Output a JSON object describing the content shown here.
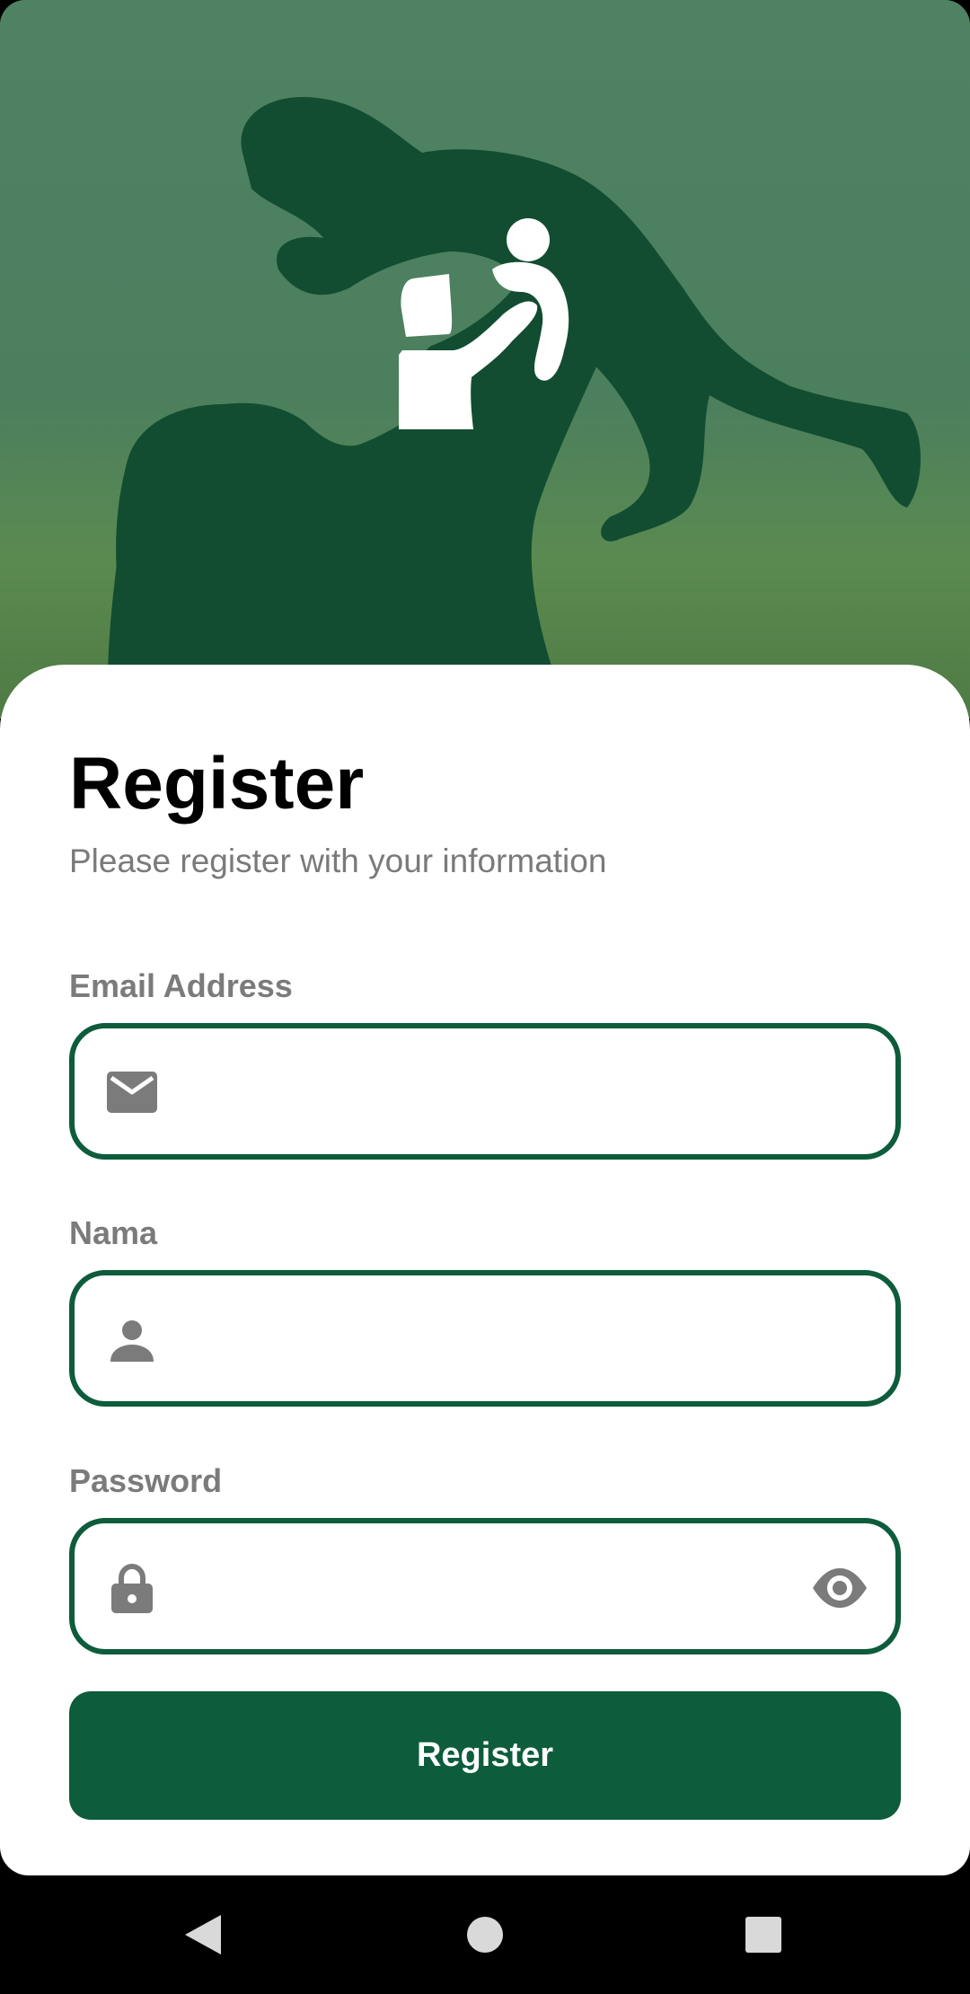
{
  "hero": {
    "logo_icon": "parent-lifting-child-icon"
  },
  "form": {
    "title": "Register",
    "subtitle": "Please register with your information",
    "email": {
      "label": "Email Address",
      "value": "",
      "placeholder": "",
      "icon": "mail-icon"
    },
    "name": {
      "label": "Nama",
      "value": "",
      "placeholder": "",
      "icon": "person-icon"
    },
    "password": {
      "label": "Password",
      "value": "",
      "placeholder": "",
      "icon": "lock-icon",
      "toggle_icon": "eye-icon"
    },
    "submit_label": "Register"
  },
  "colors": {
    "accent": "#0d5c3b",
    "hero_green": "#4f8263",
    "label_gray": "#7b7b7b"
  },
  "navbar": {
    "back_icon": "back-triangle-icon",
    "home_icon": "home-circle-icon",
    "recents_icon": "recents-square-icon"
  }
}
